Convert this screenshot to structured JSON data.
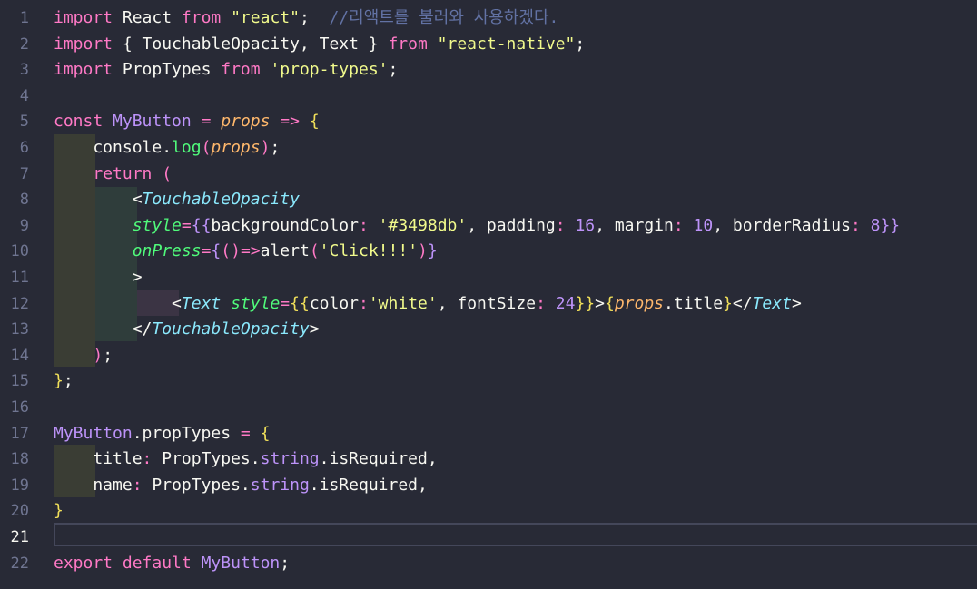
{
  "editor": {
    "active_line": "21",
    "line_numbers": [
      "1",
      "2",
      "3",
      "4",
      "5",
      "6",
      "7",
      "8",
      "9",
      "10",
      "11",
      "12",
      "13",
      "14",
      "15",
      "16",
      "17",
      "18",
      "19",
      "20",
      "21",
      "22"
    ],
    "lines": [
      [
        {
          "t": "import",
          "c": "k"
        },
        {
          "t": " React ",
          "c": "w"
        },
        {
          "t": "from",
          "c": "k"
        },
        {
          "t": " ",
          "c": "w"
        },
        {
          "t": "\"react\"",
          "c": "s"
        },
        {
          "t": ";  ",
          "c": "w"
        },
        {
          "t": "//리액트를 불러와 사용하겠다.",
          "c": "c"
        }
      ],
      [
        {
          "t": "import",
          "c": "k"
        },
        {
          "t": " { TouchableOpacity, Text } ",
          "c": "w"
        },
        {
          "t": "from",
          "c": "k"
        },
        {
          "t": " ",
          "c": "w"
        },
        {
          "t": "\"react-native\"",
          "c": "s"
        },
        {
          "t": ";",
          "c": "w"
        }
      ],
      [
        {
          "t": "import",
          "c": "k"
        },
        {
          "t": " PropTypes ",
          "c": "w"
        },
        {
          "t": "from",
          "c": "k"
        },
        {
          "t": " ",
          "c": "w"
        },
        {
          "t": "'prop-types'",
          "c": "s"
        },
        {
          "t": ";",
          "c": "w"
        }
      ],
      [],
      [
        {
          "t": "const",
          "c": "k"
        },
        {
          "t": " ",
          "c": "w"
        },
        {
          "t": "MyButton",
          "c": "pl"
        },
        {
          "t": " ",
          "c": "w"
        },
        {
          "t": "=",
          "c": "o"
        },
        {
          "t": " ",
          "c": "w"
        },
        {
          "t": "props",
          "c": "p"
        },
        {
          "t": " ",
          "c": "w"
        },
        {
          "t": "=>",
          "c": "o"
        },
        {
          "t": " ",
          "c": "w"
        },
        {
          "t": "{",
          "c": "br1"
        }
      ],
      [
        {
          "t": "    console.",
          "c": "w"
        },
        {
          "t": "log",
          "c": "f"
        },
        {
          "t": "(",
          "c": "br2"
        },
        {
          "t": "props",
          "c": "p"
        },
        {
          "t": ")",
          "c": "br2"
        },
        {
          "t": ";",
          "c": "w"
        }
      ],
      [
        {
          "t": "    ",
          "c": "w"
        },
        {
          "t": "return",
          "c": "k"
        },
        {
          "t": " ",
          "c": "w"
        },
        {
          "t": "(",
          "c": "br2"
        }
      ],
      [
        {
          "t": "        <",
          "c": "w"
        },
        {
          "t": "TouchableOpacity",
          "c": "t"
        }
      ],
      [
        {
          "t": "        ",
          "c": "w"
        },
        {
          "t": "style",
          "c": "a"
        },
        {
          "t": "=",
          "c": "o"
        },
        {
          "t": "{{",
          "c": "br3"
        },
        {
          "t": "backgroundColor",
          "c": "w"
        },
        {
          "t": ": ",
          "c": "o"
        },
        {
          "t": "'#3498db'",
          "c": "s"
        },
        {
          "t": ", padding",
          "c": "w"
        },
        {
          "t": ": ",
          "c": "o"
        },
        {
          "t": "16",
          "c": "n"
        },
        {
          "t": ", margin",
          "c": "w"
        },
        {
          "t": ": ",
          "c": "o"
        },
        {
          "t": "10",
          "c": "n"
        },
        {
          "t": ", borderRadius",
          "c": "w"
        },
        {
          "t": ": ",
          "c": "o"
        },
        {
          "t": "8",
          "c": "n"
        },
        {
          "t": "}}",
          "c": "br3"
        }
      ],
      [
        {
          "t": "        ",
          "c": "w"
        },
        {
          "t": "onPress",
          "c": "a"
        },
        {
          "t": "=",
          "c": "o"
        },
        {
          "t": "{",
          "c": "br3"
        },
        {
          "t": "()",
          "c": "br2"
        },
        {
          "t": "=>",
          "c": "o"
        },
        {
          "t": "alert",
          "c": "w"
        },
        {
          "t": "(",
          "c": "br2"
        },
        {
          "t": "'Click!!!'",
          "c": "s"
        },
        {
          "t": ")",
          "c": "br2"
        },
        {
          "t": "}",
          "c": "br3"
        }
      ],
      [
        {
          "t": "        >",
          "c": "w"
        }
      ],
      [
        {
          "t": "            <",
          "c": "w"
        },
        {
          "t": "Text",
          "c": "t"
        },
        {
          "t": " ",
          "c": "w"
        },
        {
          "t": "style",
          "c": "a"
        },
        {
          "t": "=",
          "c": "o"
        },
        {
          "t": "{{",
          "c": "br1"
        },
        {
          "t": "color",
          "c": "w"
        },
        {
          "t": ":",
          "c": "o"
        },
        {
          "t": "'white'",
          "c": "s"
        },
        {
          "t": ", fontSize",
          "c": "w"
        },
        {
          "t": ": ",
          "c": "o"
        },
        {
          "t": "24",
          "c": "n"
        },
        {
          "t": "}}",
          "c": "br1"
        },
        {
          "t": ">",
          "c": "w"
        },
        {
          "t": "{",
          "c": "br1"
        },
        {
          "t": "props",
          "c": "p"
        },
        {
          "t": ".title",
          "c": "w"
        },
        {
          "t": "}",
          "c": "br1"
        },
        {
          "t": "</",
          "c": "w"
        },
        {
          "t": "Text",
          "c": "t"
        },
        {
          "t": ">",
          "c": "w"
        }
      ],
      [
        {
          "t": "        </",
          "c": "w"
        },
        {
          "t": "TouchableOpacity",
          "c": "t"
        },
        {
          "t": ">",
          "c": "w"
        }
      ],
      [
        {
          "t": "    ",
          "c": "w"
        },
        {
          "t": ")",
          "c": "br2"
        },
        {
          "t": ";",
          "c": "w"
        }
      ],
      [
        {
          "t": "}",
          "c": "br1"
        },
        {
          "t": ";",
          "c": "w"
        }
      ],
      [],
      [
        {
          "t": "MyButton",
          "c": "pl"
        },
        {
          "t": ".propTypes ",
          "c": "w"
        },
        {
          "t": "=",
          "c": "o"
        },
        {
          "t": " ",
          "c": "w"
        },
        {
          "t": "{",
          "c": "br1"
        }
      ],
      [
        {
          "t": "    title",
          "c": "w"
        },
        {
          "t": ": ",
          "c": "o"
        },
        {
          "t": "PropTypes.",
          "c": "w"
        },
        {
          "t": "string",
          "c": "pl"
        },
        {
          "t": ".isRequired,",
          "c": "w"
        }
      ],
      [
        {
          "t": "    name",
          "c": "w"
        },
        {
          "t": ": ",
          "c": "o"
        },
        {
          "t": "PropTypes.",
          "c": "w"
        },
        {
          "t": "string",
          "c": "pl"
        },
        {
          "t": ".isRequired,",
          "c": "w"
        }
      ],
      [
        {
          "t": "}",
          "c": "br1"
        }
      ],
      [],
      [
        {
          "t": "export",
          "c": "k"
        },
        {
          "t": " ",
          "c": "w"
        },
        {
          "t": "default",
          "c": "k"
        },
        {
          "t": " ",
          "c": "w"
        },
        {
          "t": "MyButton",
          "c": "pl"
        },
        {
          "t": ";",
          "c": "w"
        }
      ]
    ]
  }
}
